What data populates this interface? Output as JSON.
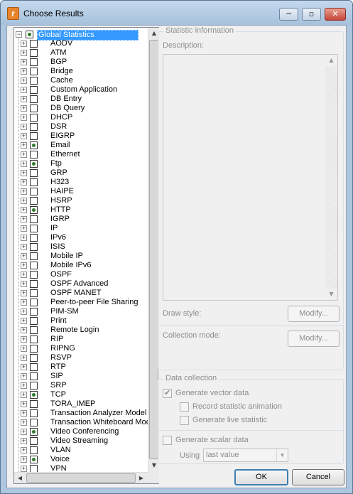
{
  "window": {
    "title": "Choose Results",
    "minimize_glyph": "─",
    "maximize_glyph": "▫",
    "close_glyph": "✕",
    "app_icon_letter": "r"
  },
  "tree": {
    "root": {
      "label": "Global Statistics",
      "checked": true
    },
    "items": [
      {
        "label": "AODV",
        "checked": false
      },
      {
        "label": "ATM",
        "checked": false
      },
      {
        "label": "BGP",
        "checked": false
      },
      {
        "label": "Bridge",
        "checked": false
      },
      {
        "label": "Cache",
        "checked": false
      },
      {
        "label": "Custom Application",
        "checked": false
      },
      {
        "label": "DB Entry",
        "checked": false
      },
      {
        "label": "DB Query",
        "checked": false
      },
      {
        "label": "DHCP",
        "checked": false
      },
      {
        "label": "DSR",
        "checked": false
      },
      {
        "label": "EIGRP",
        "checked": false
      },
      {
        "label": "Email",
        "checked": true
      },
      {
        "label": "Ethernet",
        "checked": false
      },
      {
        "label": "Ftp",
        "checked": true
      },
      {
        "label": "GRP",
        "checked": false
      },
      {
        "label": "H323",
        "checked": false
      },
      {
        "label": "HAIPE",
        "checked": false
      },
      {
        "label": "HSRP",
        "checked": false
      },
      {
        "label": "HTTP",
        "checked": true
      },
      {
        "label": "IGRP",
        "checked": false
      },
      {
        "label": "IP",
        "checked": false
      },
      {
        "label": "IPv6",
        "checked": false
      },
      {
        "label": "ISIS",
        "checked": false
      },
      {
        "label": "Mobile IP",
        "checked": false
      },
      {
        "label": "Mobile IPv6",
        "checked": false
      },
      {
        "label": "OSPF",
        "checked": false
      },
      {
        "label": "OSPF Advanced",
        "checked": false
      },
      {
        "label": "OSPF MANET",
        "checked": false
      },
      {
        "label": "Peer-to-peer File Sharing",
        "checked": false
      },
      {
        "label": "PIM-SM",
        "checked": false
      },
      {
        "label": "Print",
        "checked": false
      },
      {
        "label": "Remote Login",
        "checked": false
      },
      {
        "label": "RIP",
        "checked": false
      },
      {
        "label": "RIPNG",
        "checked": false
      },
      {
        "label": "RSVP",
        "checked": false
      },
      {
        "label": "RTP",
        "checked": false
      },
      {
        "label": "SIP",
        "checked": false
      },
      {
        "label": "SRP",
        "checked": false
      },
      {
        "label": "TCP",
        "checked": true
      },
      {
        "label": "TORA_IMEP",
        "checked": false
      },
      {
        "label": "Transaction Analyzer Model",
        "checked": false
      },
      {
        "label": "Transaction Whiteboard Model",
        "checked": false
      },
      {
        "label": "Video Conferencing",
        "checked": true
      },
      {
        "label": "Video Streaming",
        "checked": false
      },
      {
        "label": "VLAN",
        "checked": false
      },
      {
        "label": "Voice",
        "checked": true
      },
      {
        "label": "VPN",
        "checked": false
      }
    ]
  },
  "statistic_info": {
    "group_title": "Statistic information",
    "description_label": "Description:",
    "draw_style_label": "Draw style:",
    "draw_style_button": "Modify...",
    "collection_mode_label": "Collection mode:",
    "collection_mode_button": "Modify..."
  },
  "data_collection": {
    "group_title": "Data collection",
    "generate_vector": {
      "label": "Generate vector data",
      "checked": true
    },
    "record_animation": {
      "label": "Record statistic animation",
      "checked": false
    },
    "generate_live": {
      "label": "Generate live statistic",
      "checked": false
    },
    "generate_scalar": {
      "label": "Generate scalar data",
      "checked": false
    },
    "using_label": "Using",
    "using_value": "last value"
  },
  "footer": {
    "ok_label": "OK",
    "cancel_label": "Cancel"
  },
  "colors": {
    "selection": "#3399ff",
    "checked_dot": "#2c7a2c",
    "window_frame": "#aec6de"
  }
}
